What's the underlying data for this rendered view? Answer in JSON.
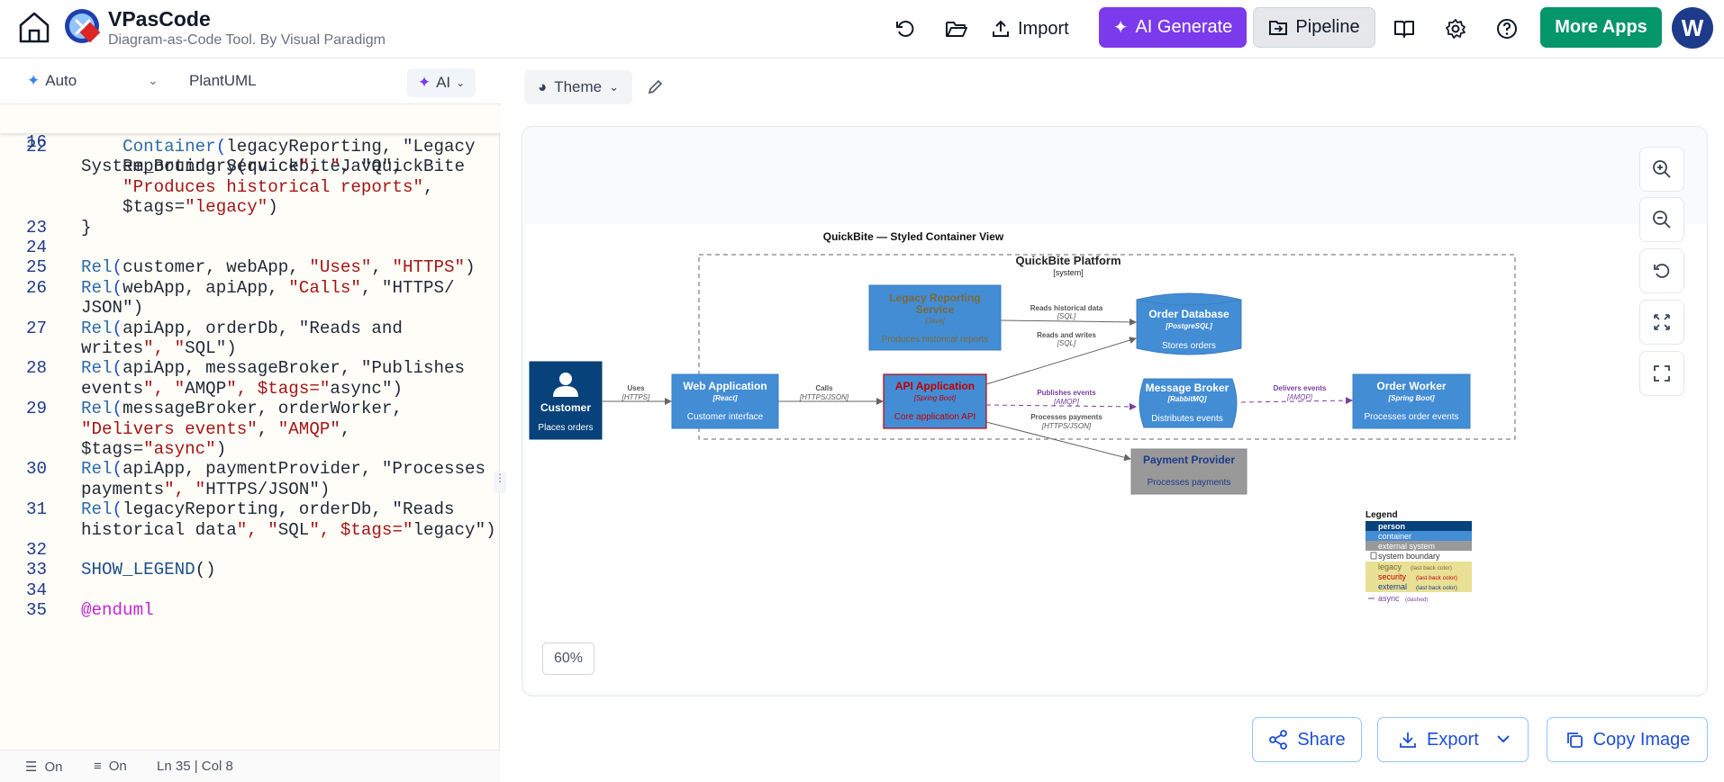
{
  "header": {
    "app_name": "VPasCode",
    "subtitle": "Diagram-as-Code Tool. By Visual Paradigm",
    "import_label": "Import",
    "ai_generate_label": "AI Generate",
    "pipeline_label": "Pipeline",
    "more_apps_label": "More Apps",
    "avatar_initial": "W",
    "colors": {
      "ai": "#7c3aed",
      "more_apps": "#059669",
      "avatar": "#1e3a8a"
    }
  },
  "editor": {
    "mode_label": "Auto",
    "language_label": "PlantUML",
    "ai_label": "AI",
    "sticky_line": {
      "num": "16",
      "text": "System_Boundary(quickbite, \"QuickBite"
    },
    "lines": [
      {
        "num": "22",
        "text": "    Container(legacyReporting, \"Legacy"
      },
      {
        "num": "",
        "text": "    Reporting Service\", \"Java\","
      },
      {
        "num": "",
        "text": "    \"Produces historical reports\","
      },
      {
        "num": "",
        "text": "    $tags=\"legacy\")"
      },
      {
        "num": "23",
        "text": "}"
      },
      {
        "num": "24",
        "text": ""
      },
      {
        "num": "25",
        "text": "Rel(customer, webApp, \"Uses\", \"HTTPS\")"
      },
      {
        "num": "26",
        "text": "Rel(webApp, apiApp, \"Calls\", \"HTTPS/"
      },
      {
        "num": "",
        "text": "JSON\")"
      },
      {
        "num": "27",
        "text": "Rel(apiApp, orderDb, \"Reads and"
      },
      {
        "num": "",
        "text": "writes\", \"SQL\")"
      },
      {
        "num": "28",
        "text": "Rel(apiApp, messageBroker, \"Publishes"
      },
      {
        "num": "",
        "text": "events\", \"AMQP\", $tags=\"async\")"
      },
      {
        "num": "29",
        "text": "Rel(messageBroker, orderWorker,"
      },
      {
        "num": "",
        "text": "\"Delivers events\", \"AMQP\","
      },
      {
        "num": "",
        "text": "$tags=\"async\")"
      },
      {
        "num": "30",
        "text": "Rel(apiApp, paymentProvider, \"Processes"
      },
      {
        "num": "",
        "text": "payments\", \"HTTPS/JSON\")"
      },
      {
        "num": "31",
        "text": "Rel(legacyReporting, orderDb, \"Reads"
      },
      {
        "num": "",
        "text": "historical data\", \"SQL\", $tags=\"legacy\")"
      },
      {
        "num": "32",
        "text": ""
      },
      {
        "num": "33",
        "text": "SHOW_LEGEND()"
      },
      {
        "num": "34",
        "text": ""
      },
      {
        "num": "35",
        "text": "@enduml"
      }
    ],
    "status": {
      "wrap": "On",
      "format": "On",
      "position": "Ln 35 | Col 8"
    }
  },
  "preview": {
    "theme_label": "Theme",
    "zoom_level": "60%",
    "share_label": "Share",
    "export_label": "Export",
    "copy_image_label": "Copy Image"
  },
  "diagram": {
    "title": "QuickBite — Styled Container View",
    "boundary": {
      "name": "QuickBite Platform",
      "type": "[system]"
    },
    "customer": {
      "name": "Customer",
      "desc": "Places orders"
    },
    "web_app": {
      "name": "Web Application",
      "tech": "[React]",
      "desc": "Customer interface"
    },
    "api_app": {
      "name": "API Application",
      "tech": "[Spring Boot]",
      "desc": "Core application API"
    },
    "legacy": {
      "name_1": "Legacy Reporting",
      "name_2": "Service",
      "tech": "[Java]",
      "desc": "Produces historical reports"
    },
    "order_db": {
      "name": "Order Database",
      "tech": "[PostgreSQL]",
      "desc": "Stores orders"
    },
    "broker": {
      "name": "Message Broker",
      "tech": "[RabbitMQ]",
      "desc": "Distributes events"
    },
    "worker": {
      "name": "Order Worker",
      "tech": "[Spring Boot]",
      "desc": "Processes order events"
    },
    "payment": {
      "name": "Payment Provider",
      "desc": "Processes payments"
    },
    "rels": {
      "uses": "Uses",
      "uses_tech": "[HTTPS]",
      "calls": "Calls",
      "calls_tech": "[HTTPS/JSON]",
      "reads_hist": "Reads historical data",
      "reads_hist_tech": "[SQL]",
      "reads_writes": "Reads and writes",
      "reads_writes_tech": "[SQL]",
      "publishes": "Publishes events",
      "publishes_tech": "[AMQP]",
      "delivers": "Delivers events",
      "delivers_tech": "[AMQP]",
      "payments": "Processes payments",
      "payments_tech": "[HTTPS/JSON]"
    },
    "legend": {
      "title": "Legend",
      "person": "person",
      "container": "container",
      "external": "external system",
      "boundary": "system boundary",
      "legacy": "legacy",
      "legacy_note": "(last back color)",
      "security": "security",
      "security_note": "(last back color)",
      "external_tag": "external",
      "external_note": "(last back color)",
      "async": "async",
      "async_note": "(dashed)"
    },
    "colors": {
      "person": "#08427b",
      "container": "#438dd5",
      "external": "#999999",
      "legacy": "#e2c87a",
      "async": "#7b3fa0",
      "security_text": "#c00000"
    }
  }
}
